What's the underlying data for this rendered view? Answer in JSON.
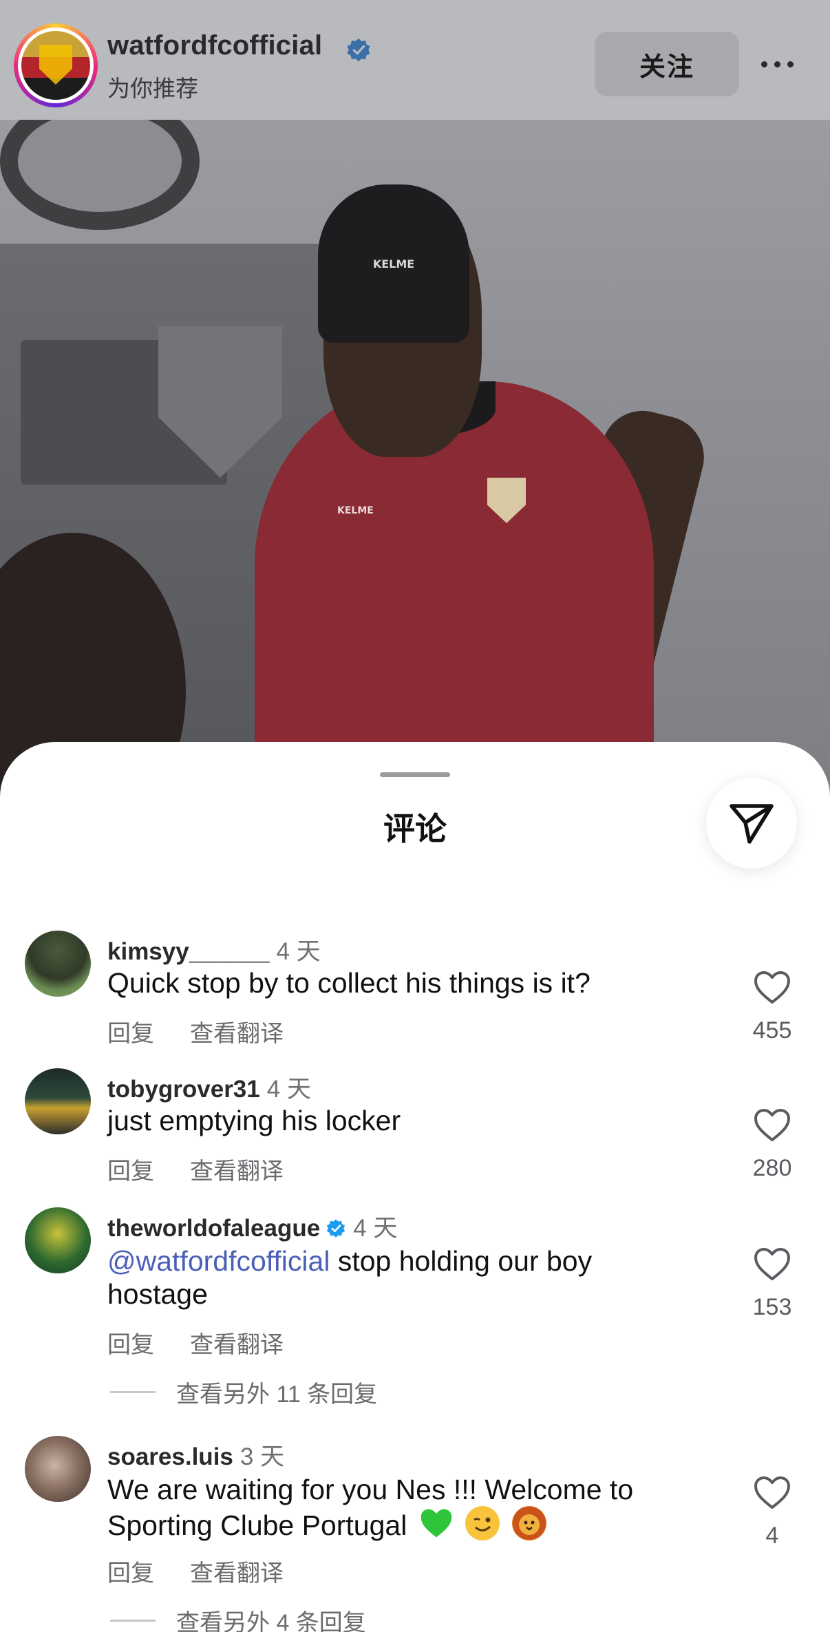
{
  "post_header": {
    "account": "watfordfcofficial",
    "subtitle": "为你推荐",
    "follow_label": "关注",
    "verified_icon": "verified-badge-icon",
    "more_icon": "more-dots-icon"
  },
  "photo": {
    "beanie_brand": "KELME",
    "shirt_brand": "KELME"
  },
  "sheet": {
    "title": "评论",
    "share_icon": "send-icon"
  },
  "comments": [
    {
      "user": "kimsyy______",
      "time": "4 天",
      "verified": false,
      "text": "Quick stop by to collect his things is it?",
      "reply": "回复",
      "translate": "查看翻译",
      "likes": "455"
    },
    {
      "user": "tobygrover31",
      "time": "4 天",
      "verified": false,
      "text": "just emptying his locker",
      "reply": "回复",
      "translate": "查看翻译",
      "likes": "280"
    },
    {
      "user": "theworldofaleague",
      "time": "4 天",
      "verified": true,
      "mention": "@watfordfcofficial",
      "text": " stop holding our boy hostage",
      "reply": "回复",
      "translate": "查看翻译",
      "likes": "153",
      "more_replies": "查看另外 11 条回复"
    },
    {
      "user": "soares.luis",
      "time": "3 天",
      "verified": false,
      "text": "We are waiting for you Nes !!! Welcome to Sporting Clube Portugal",
      "emojis": [
        "green-heart",
        "winking-face",
        "lion-face"
      ],
      "reply": "回复",
      "translate": "查看翻译",
      "likes": "4",
      "more_replies": "查看另外 4 条回复"
    }
  ],
  "colors": {
    "mention": "#4b5fb8",
    "verified": "#1d9bf0",
    "secondary_text": "#6a6a6f"
  }
}
